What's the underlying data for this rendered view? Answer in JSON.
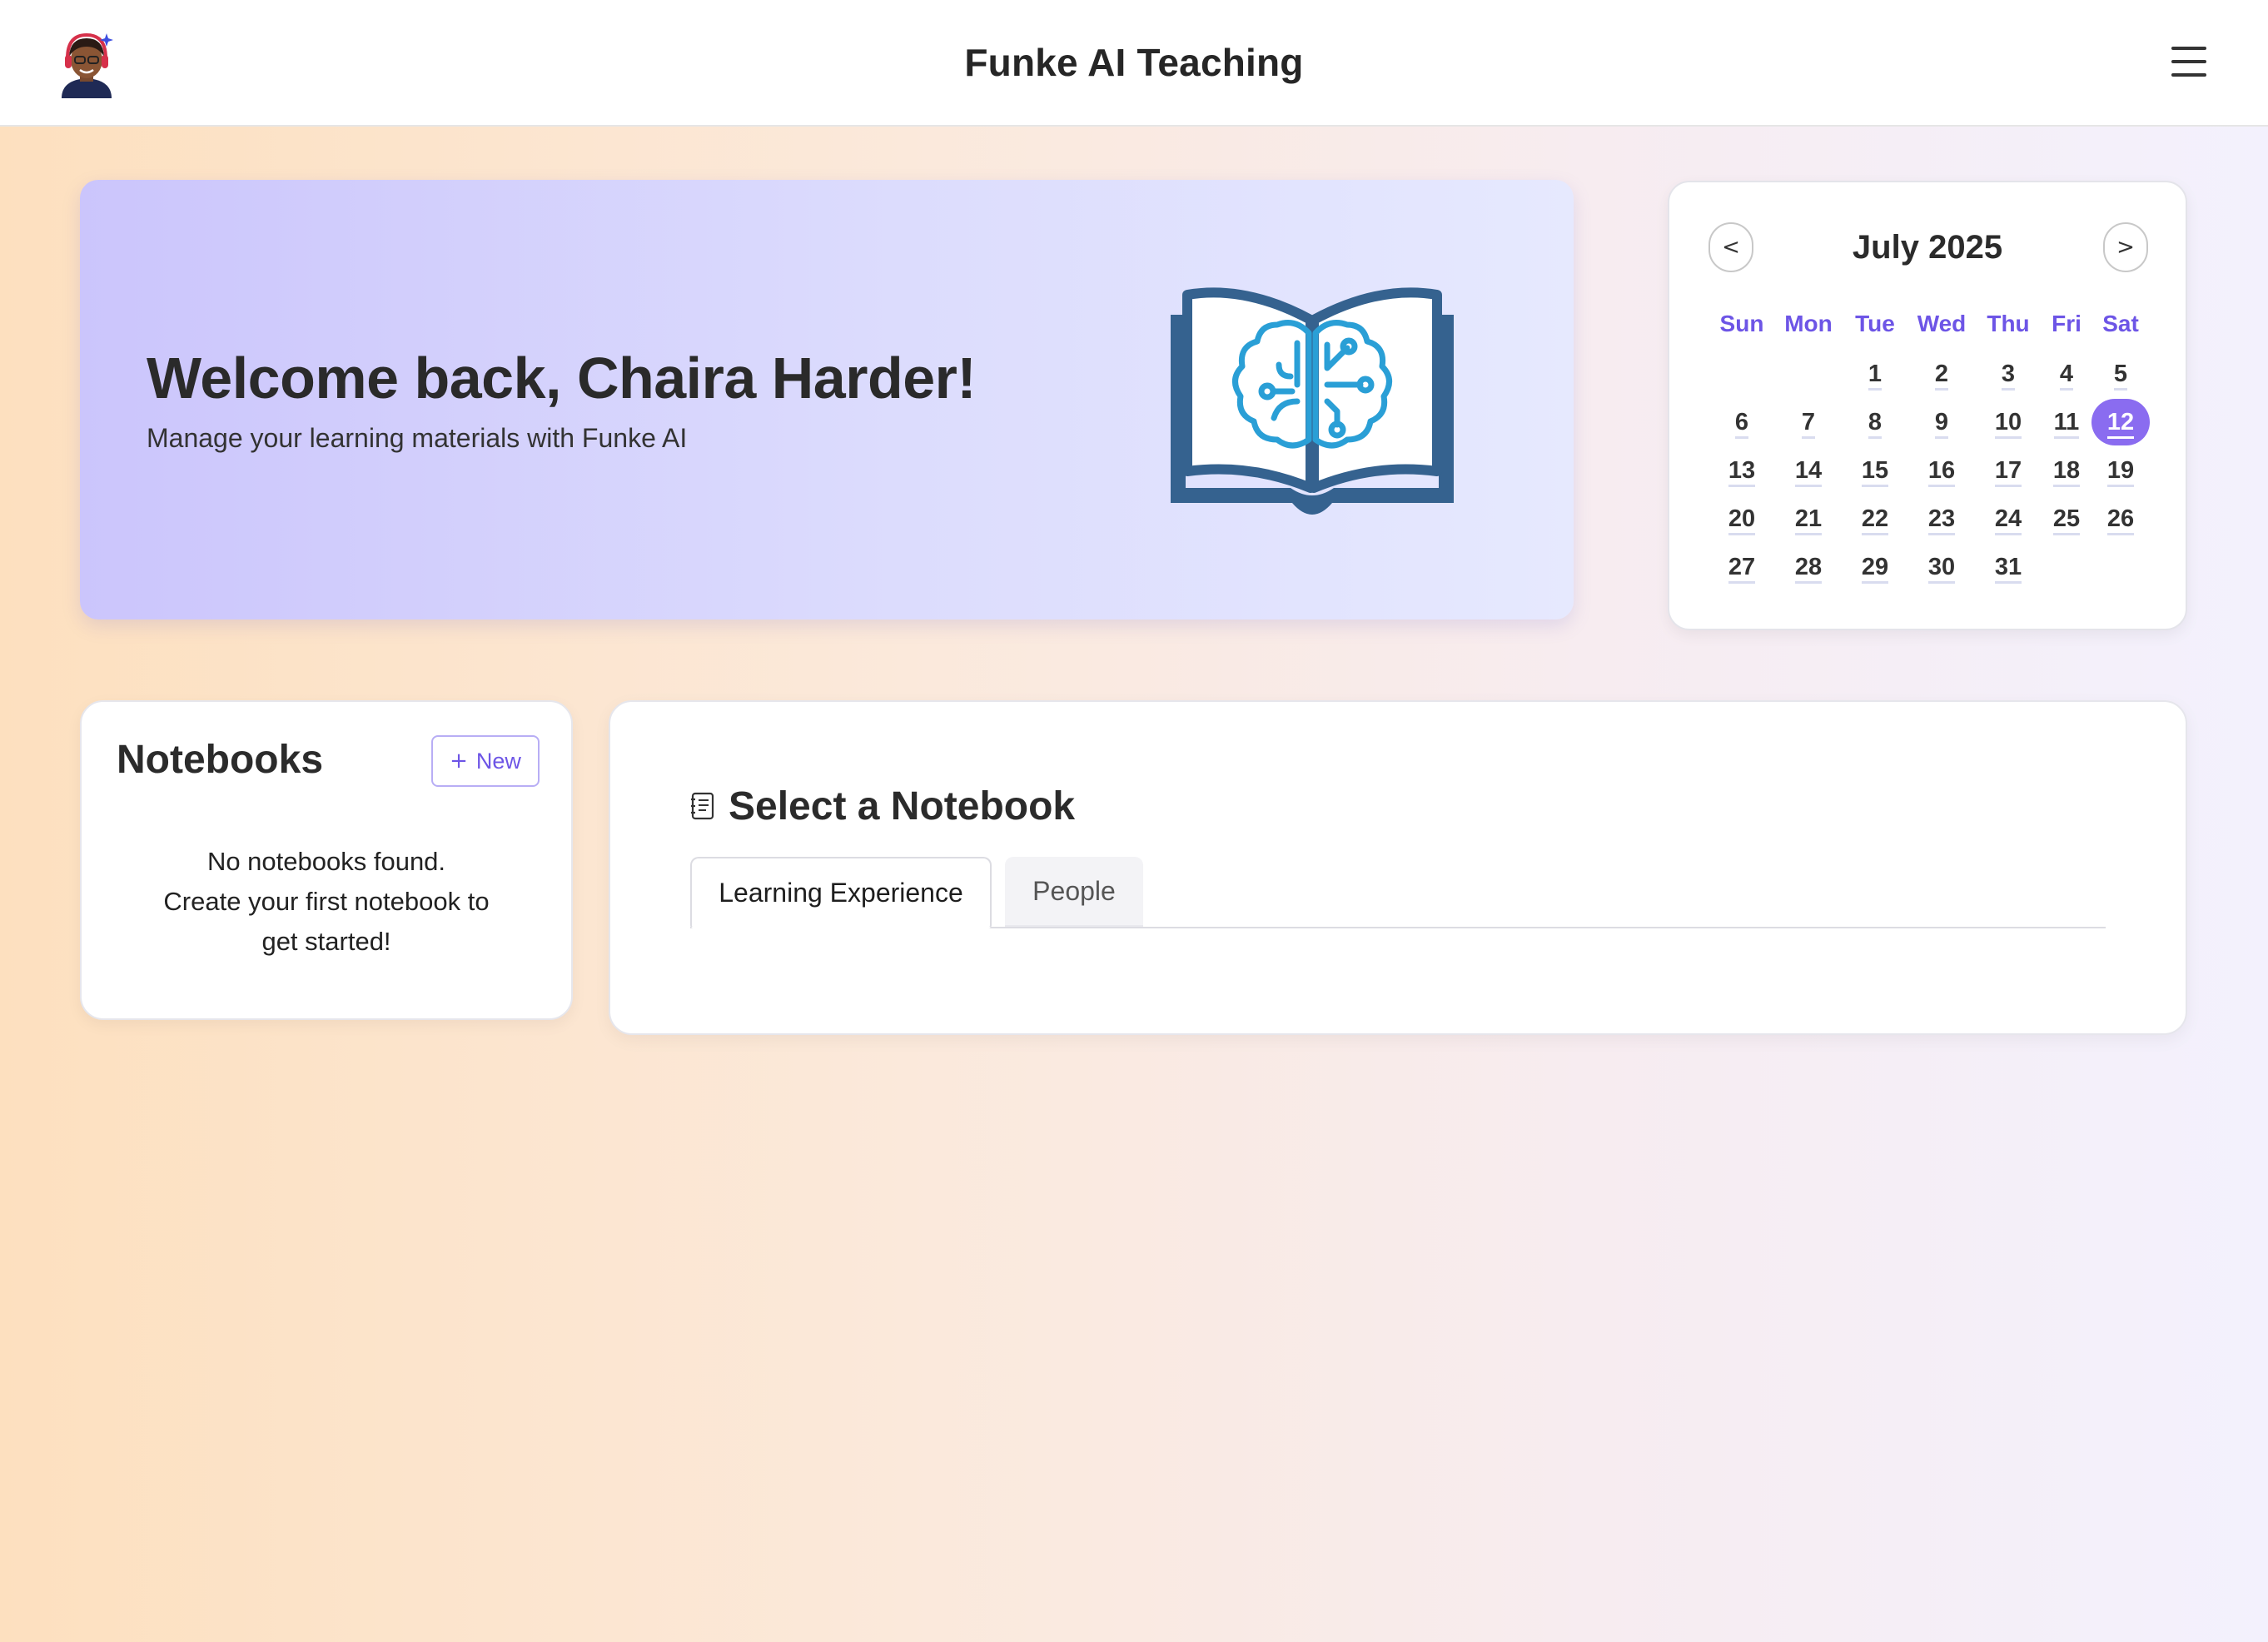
{
  "header": {
    "title": "Funke AI Teaching",
    "avatar_icon": "avatar-icon",
    "menu_icon": "hamburger-menu-icon"
  },
  "welcome": {
    "title": "Welcome back, Chaira Harder!",
    "subtitle": "Manage your learning materials with Funke AI",
    "illustration_icon": "book-brain-icon"
  },
  "calendar": {
    "prev_label": "<",
    "next_label": ">",
    "month_label": "July 2025",
    "weekdays": [
      "Sun",
      "Mon",
      "Tue",
      "Wed",
      "Thu",
      "Fri",
      "Sat"
    ],
    "first_weekday_index": 2,
    "days_in_month": 31,
    "selected_day": 12,
    "days": [
      "1",
      "2",
      "3",
      "4",
      "5",
      "6",
      "7",
      "8",
      "9",
      "10",
      "11",
      "12",
      "13",
      "14",
      "15",
      "16",
      "17",
      "18",
      "19",
      "20",
      "21",
      "22",
      "23",
      "24",
      "25",
      "26",
      "27",
      "28",
      "29",
      "30",
      "31"
    ]
  },
  "notebooks": {
    "title": "Notebooks",
    "new_button": {
      "icon": "+",
      "label": "New"
    },
    "empty_line1": "No notebooks found.",
    "empty_line2": "Create your first notebook to",
    "empty_line3": "get started!"
  },
  "selector": {
    "title": "Select a Notebook",
    "icon": "notebook-icon",
    "tabs": [
      {
        "label": "Learning Experience",
        "active": true
      },
      {
        "label": "People",
        "active": false
      }
    ]
  },
  "colors": {
    "accent": "#6d55e6",
    "today_bg": "#8a6cf0",
    "book_dark": "#34628f",
    "brain_blue": "#2a9fd6"
  }
}
